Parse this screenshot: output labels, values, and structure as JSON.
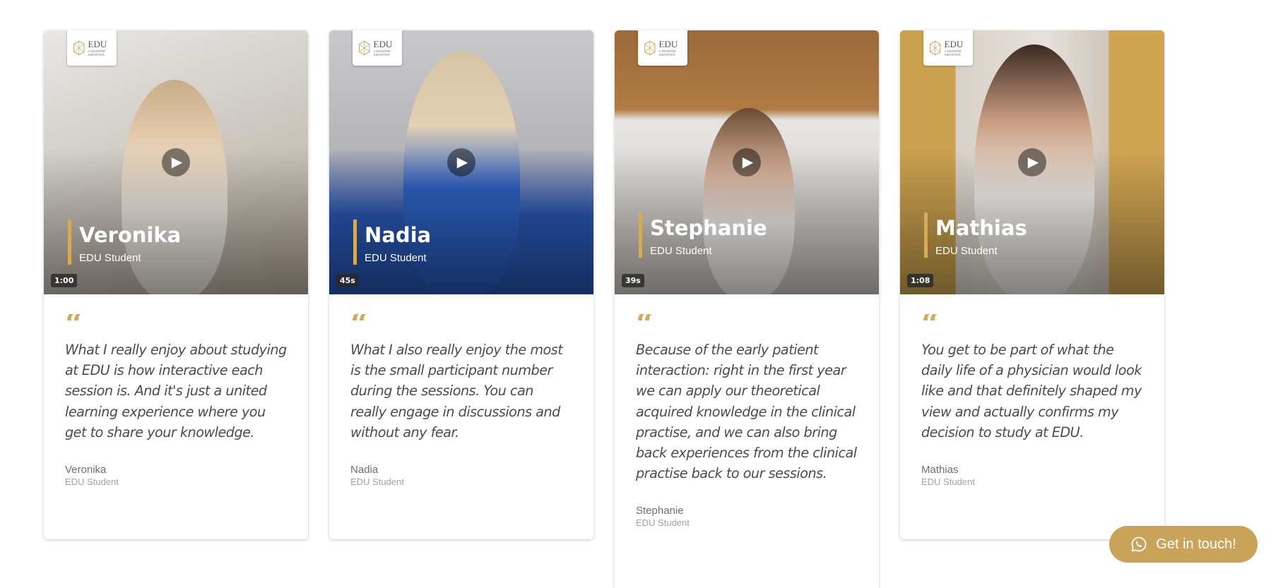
{
  "brand": {
    "logo_text": "EDU",
    "logo_tagline": "A DEGREE SMARTER.",
    "accent": "#d3ab5b"
  },
  "testimonials": [
    {
      "name": "Veronika",
      "role": "EDU Student",
      "duration": "1:00",
      "quote": "What I really enjoy about studying at EDU is how interactive each session is. And it's just a united learning experience where you get to share your knowledge."
    },
    {
      "name": "Nadia",
      "role": "EDU Student",
      "duration": "45s",
      "quote": "What I also really enjoy the most is the small participant number during the sessions. You can really engage in discussions and without any fear."
    },
    {
      "name": "Stephanie",
      "role": "EDU Student",
      "duration": "39s",
      "quote": "Because of the early patient interaction: right in the first year we can apply our theoretical acquired knowledge in the clinical practise, and we can also bring back experiences from the clinical practise back to our sessions."
    },
    {
      "name": "Mathias",
      "role": "EDU Student",
      "duration": "1:08",
      "quote": "You get to be part of what the daily life of a physician would look like and that definitely shaped my view and actually confirms my decision to study at EDU."
    }
  ],
  "quote_glyph": "“",
  "play_glyph": "▶",
  "cta": {
    "label": "Get in touch!",
    "icon": "whatsapp-icon",
    "color": "#caa35a"
  }
}
